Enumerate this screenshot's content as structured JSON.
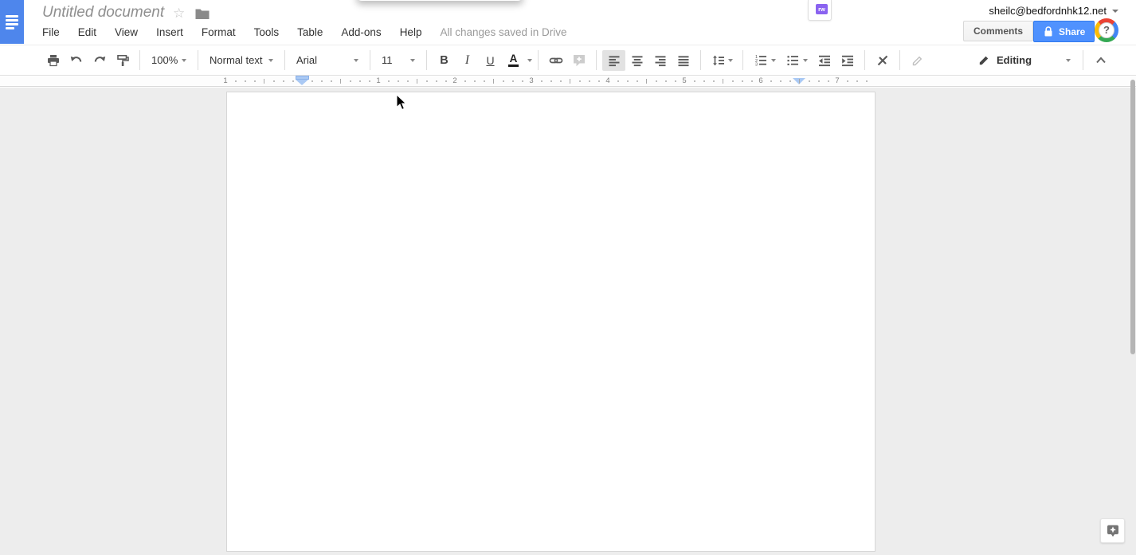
{
  "header": {
    "title": "Untitled document",
    "menu_items": [
      "File",
      "Edit",
      "View",
      "Insert",
      "Format",
      "Tools",
      "Table",
      "Add-ons",
      "Help"
    ],
    "saved_status": "All changes saved in Drive",
    "account_email": "sheilc@bedfordnhk12.net",
    "comments_label": "Comments",
    "share_label": "Share",
    "help_label": "?",
    "extension_badge": "rw"
  },
  "toolbar": {
    "zoom_value": "100%",
    "paragraph_style": "Normal text",
    "font_family": "Arial",
    "font_size": "11",
    "bold_label": "B",
    "italic_label": "I",
    "underline_label": "U",
    "text_color_label": "A",
    "mode_label": "Editing"
  },
  "ruler": {
    "numbers": [
      "1",
      "1",
      "2",
      "3",
      "4",
      "5",
      "6",
      "7"
    ]
  },
  "document": {
    "content": ""
  },
  "colors": {
    "docs_blue": "#4e86ec",
    "share_blue": "#4d90fe",
    "extension_purple": "#8a63f0",
    "toolbar_icon_gray": "#5a5a5a"
  }
}
